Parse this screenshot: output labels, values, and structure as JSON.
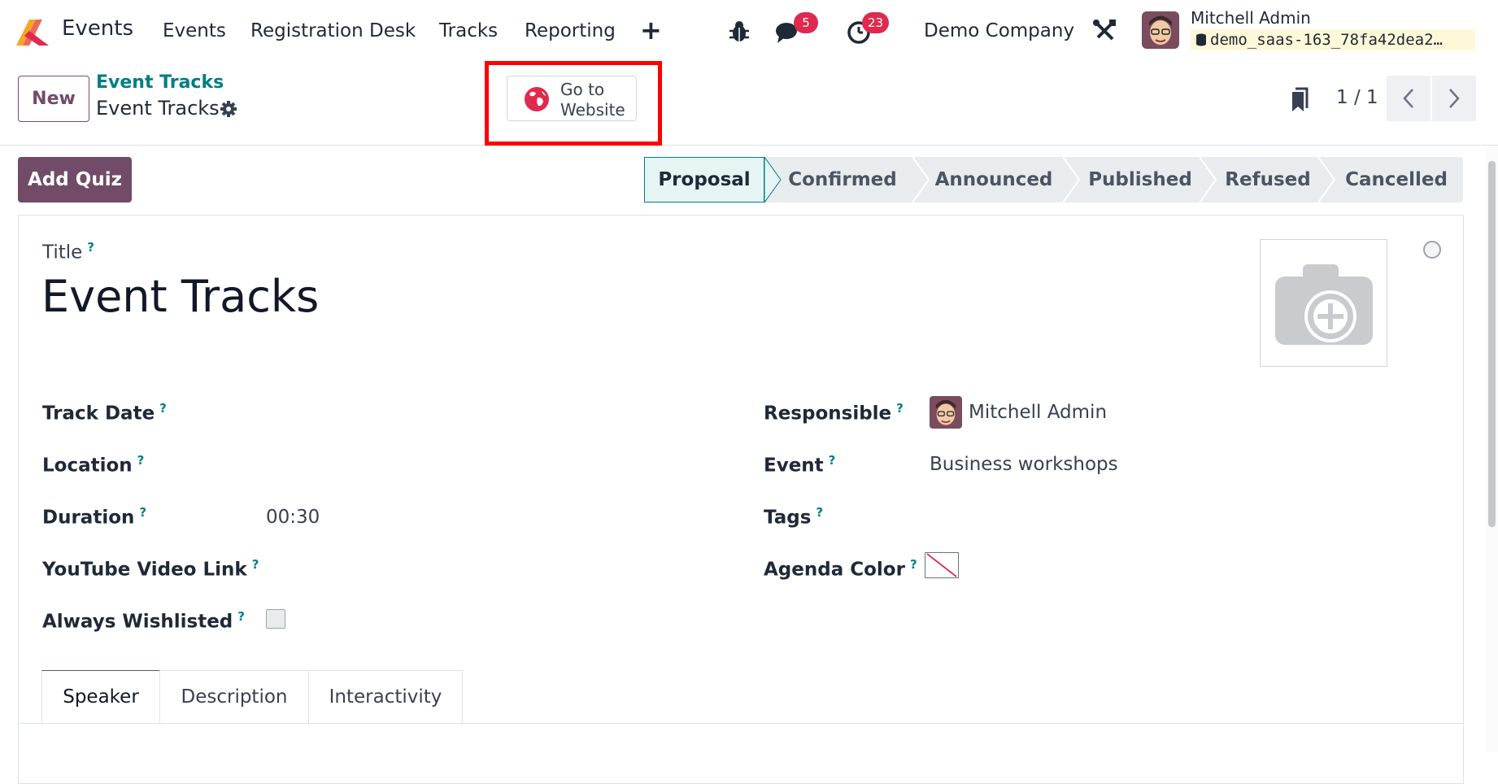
{
  "app": {
    "name": "Events",
    "menu": [
      "Events",
      "Registration Desk",
      "Tracks",
      "Reporting"
    ],
    "messages_count": "5",
    "activities_count": "23",
    "company": "Demo Company",
    "user_name": "Mitchell Admin",
    "database": "demo_saas-163_78fa42dea2…"
  },
  "control": {
    "new_label": "New",
    "breadcrumb_parent": "Event Tracks",
    "breadcrumb_current": "Event Tracks",
    "website_button_label": "Go to Website",
    "pager": "1 / 1"
  },
  "status": {
    "add_quiz_label": "Add Quiz",
    "stages": [
      "Proposal",
      "Confirmed",
      "Announced",
      "Published",
      "Refused",
      "Cancelled"
    ],
    "active_stage": "Proposal"
  },
  "form": {
    "title_label": "Title",
    "help_mark": "?",
    "title_value": "Event Tracks",
    "left_fields": [
      {
        "label": "Track Date",
        "value": ""
      },
      {
        "label": "Location",
        "value": ""
      },
      {
        "label": "Duration",
        "value": "00:30"
      },
      {
        "label": "YouTube Video Link",
        "value": ""
      },
      {
        "label": "Always Wishlisted",
        "value": ""
      }
    ],
    "right_fields": [
      {
        "label": "Responsible",
        "value": "Mitchell Admin"
      },
      {
        "label": "Event",
        "value": "Business workshops"
      },
      {
        "label": "Tags",
        "value": ""
      },
      {
        "label": "Agenda Color",
        "value": ""
      }
    ],
    "always_wishlisted": false
  },
  "tabs": [
    "Speaker",
    "Description",
    "Interactivity"
  ],
  "colors": {
    "brand": "#714b67",
    "teal": "#017e84",
    "badge": "#e0294f",
    "highlight": "#ff0000"
  }
}
